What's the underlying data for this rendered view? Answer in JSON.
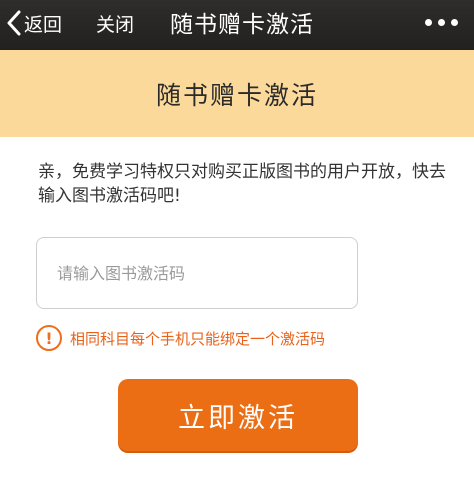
{
  "navbar": {
    "back_label": "返回",
    "close_label": "关闭",
    "title": "随书赠卡激活",
    "more_icon": "more-dots-icon"
  },
  "banner": {
    "title": "随书赠卡激活"
  },
  "intro": {
    "text": "亲，免费学习特权只对购买正版图书的用户开放，快去输入图书激活码吧!"
  },
  "activation_input": {
    "placeholder": "请输入图书激活码",
    "value": ""
  },
  "notice": {
    "icon": "warning-icon",
    "symbol": "!",
    "text": "相同科目每个手机只能绑定一个激活码"
  },
  "activate_button": {
    "label": "立即激活"
  },
  "colors": {
    "navbar_bg": "#2a2826",
    "banner_bg": "#fbd99a",
    "accent": "#ec6e14",
    "notice_text": "#e8621a"
  }
}
